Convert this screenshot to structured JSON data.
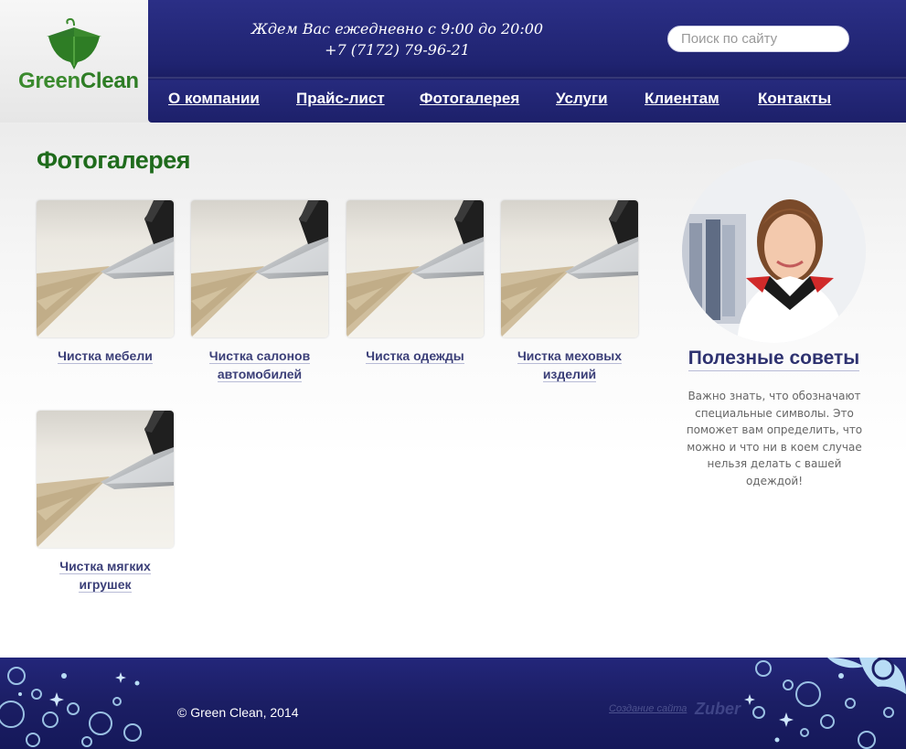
{
  "brand": {
    "name_green": "Green",
    "name_clean": "Clean"
  },
  "header": {
    "schedule_line1": "Ждем Вас ежедневно с 9:00 до 20:00",
    "phone": "+7 (7172) 79-96-21",
    "search_placeholder": "Поиск по сайту"
  },
  "nav": [
    {
      "label": "О компании"
    },
    {
      "label": "Прайс-лист"
    },
    {
      "label": "Фотогалерея"
    },
    {
      "label": "Услуги"
    },
    {
      "label": "Клиентам"
    },
    {
      "label": "Контакты"
    }
  ],
  "main": {
    "title": "Фотогалерея",
    "gallery": [
      {
        "line1": "Чистка мебели",
        "line2": ""
      },
      {
        "line1": "Чистка салонов",
        "line2": "автомобилей"
      },
      {
        "line1": "Чистка одежды",
        "line2": ""
      },
      {
        "line1": "Чистка меховых",
        "line2": "изделий"
      },
      {
        "line1": "Чистка мягких",
        "line2": "игрушек"
      }
    ]
  },
  "sidebar": {
    "title": "Полезные советы",
    "text_lines": [
      "Важно знать, что обозначают",
      "специальные символы. Это",
      "поможет вам определить, что",
      "можно и что ни в коем случае",
      "нельзя делать с вашей одеждой!"
    ]
  },
  "footer": {
    "copyright": "© Green Clean, 2014",
    "created_by": "Создание сайта",
    "studio": "Zuber"
  },
  "colors": {
    "header_blue": "#1f2370",
    "title_green": "#1f6b1c",
    "caption_blue": "#3b3f78",
    "footer_blue": "#1b1e64"
  }
}
